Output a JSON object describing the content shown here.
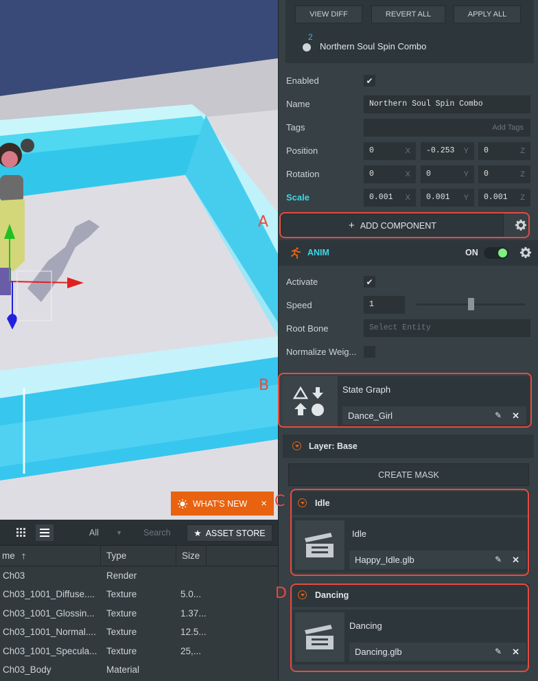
{
  "viewport": {
    "whats_new_label": "WHAT'S NEW",
    "whats_new_close": "×"
  },
  "assets": {
    "filter_value": "All",
    "search_placeholder": "Search",
    "asset_store_label": "ASSET STORE",
    "columns": {
      "name": "me",
      "type": "Type",
      "size": "Size"
    },
    "rows": [
      {
        "name": "Ch03",
        "type": "Render",
        "size": ""
      },
      {
        "name": "Ch03_1001_Diffuse....",
        "type": "Texture",
        "size": "5.0..."
      },
      {
        "name": "Ch03_1001_Glossin...",
        "type": "Texture",
        "size": "1.37..."
      },
      {
        "name": "Ch03_1001_Normal....",
        "type": "Texture",
        "size": "12.5..."
      },
      {
        "name": "Ch03_1001_Specula...",
        "type": "Texture",
        "size": "25,..."
      },
      {
        "name": "Ch03_Body",
        "type": "Material",
        "size": ""
      }
    ]
  },
  "inspector": {
    "template": {
      "view_diff": "VIEW DIFF",
      "revert_all": "REVERT ALL",
      "apply_all": "APPLY ALL",
      "item_count": "2",
      "item_name": "Northern Soul Spin Combo"
    },
    "entity": {
      "enabled_label": "Enabled",
      "name_label": "Name",
      "name_value": "Northern Soul Spin Combo",
      "tags_label": "Tags",
      "tags_placeholder": "Add Tags",
      "position_label": "Position",
      "position": [
        "0",
        "-0.253",
        "0"
      ],
      "rotation_label": "Rotation",
      "rotation": [
        "0",
        "0",
        "0"
      ],
      "scale_label": "Scale",
      "scale": [
        "0.001",
        "0.001",
        "0.001"
      ],
      "axes": [
        "X",
        "Y",
        "Z"
      ]
    },
    "add_component_label": "ADD COMPONENT",
    "anim": {
      "title": "ANIM",
      "on_label": "ON",
      "activate_label": "Activate",
      "speed_label": "Speed",
      "speed_value": "1",
      "speed_slider_fraction": 0.5,
      "root_bone_label": "Root Bone",
      "root_bone_placeholder": "Select Entity",
      "normalize_label": "Normalize Weig...",
      "state_graph_title": "State Graph",
      "state_graph_value": "Dance_Girl",
      "layer_title": "Layer: Base",
      "create_mask_label": "CREATE MASK",
      "states": [
        {
          "header": "Idle",
          "slot_title": "Idle",
          "asset": "Happy_Idle.glb"
        },
        {
          "header": "Dancing",
          "slot_title": "Dancing",
          "asset": "Dancing.glb"
        }
      ]
    }
  },
  "annotations": [
    "A",
    "B",
    "C",
    "D"
  ],
  "colors": {
    "accent": "#e8620f",
    "highlight": "#3ed6e5",
    "annotation": "#e84a3e",
    "toggle_on": "#7ff07f"
  }
}
